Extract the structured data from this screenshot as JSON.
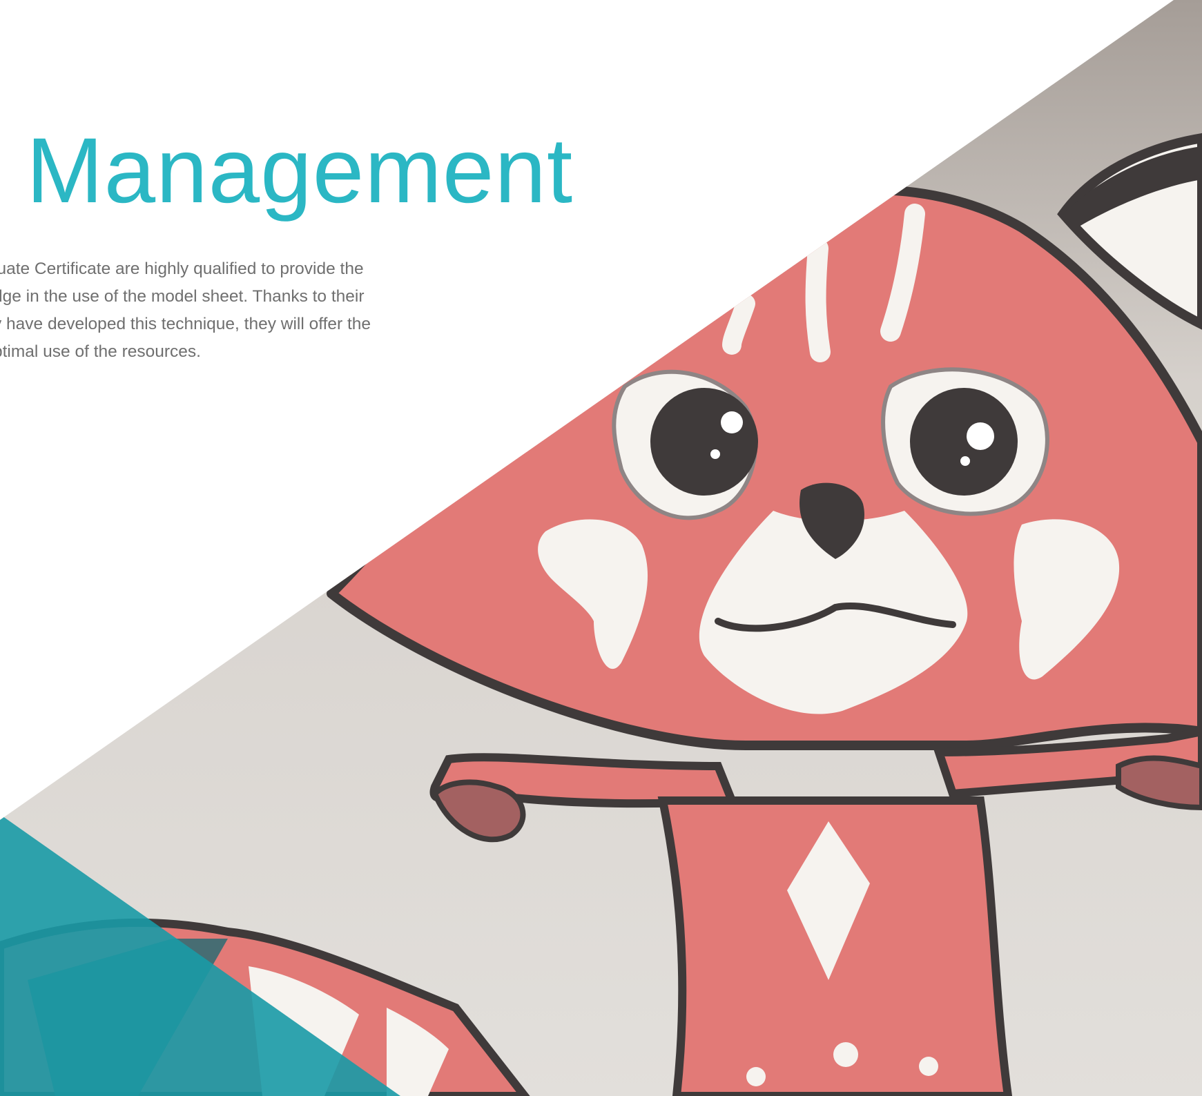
{
  "hero": {
    "title": "Management",
    "description_lines": [
      "luate Certificate are highly qualified to provide the",
      "dge in the use of the model sheet. Thanks to their",
      "y have developed this technique, they will offer the",
      "ptimal use of the resources."
    ],
    "illustration": "red-panda-model-sheet-illustration"
  },
  "colors": {
    "title": "#2bb7c4",
    "body_text": "#6f6f6f",
    "background": "#ffffff",
    "backdrop": "#dcd8d3",
    "panda_red": "#e27a77",
    "panda_dark": "#3f3a3a",
    "panda_white": "#f6f3ef",
    "teal_overlay": "#1a9aa6"
  }
}
